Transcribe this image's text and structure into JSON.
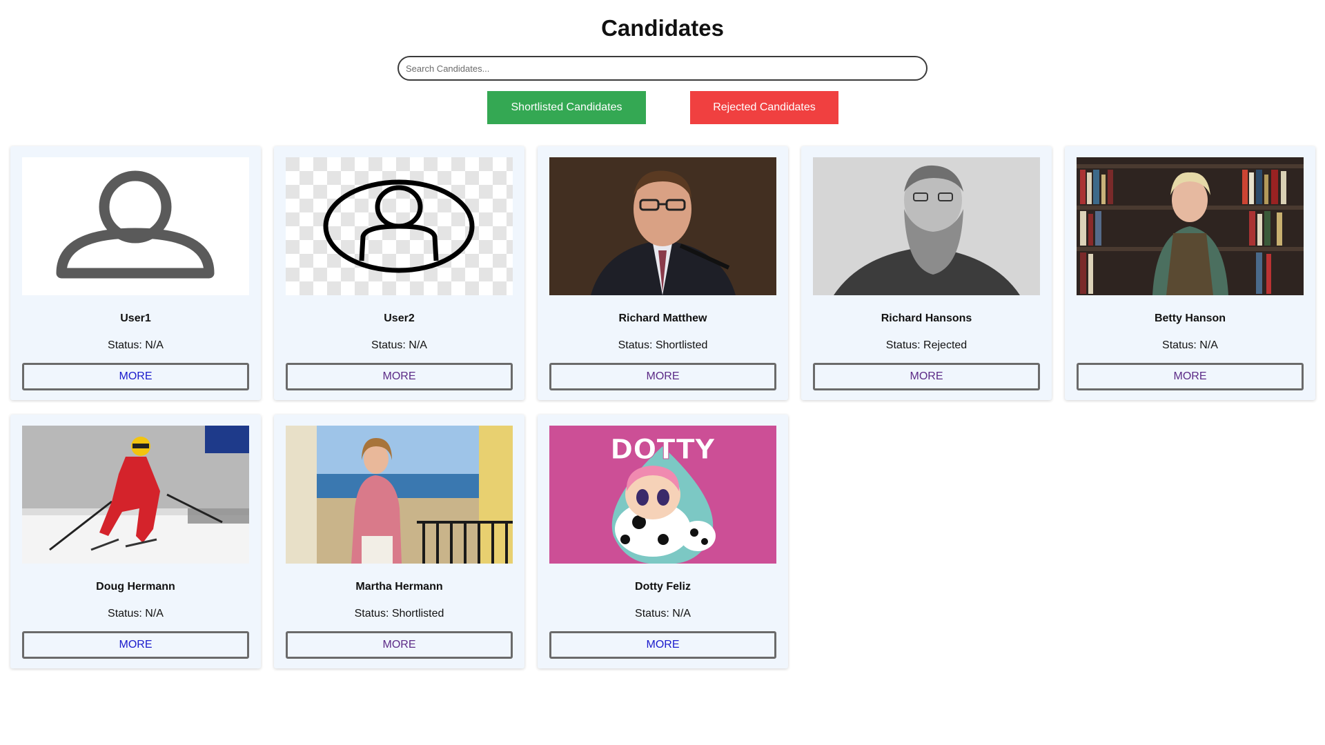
{
  "header": {
    "title": "Candidates"
  },
  "search": {
    "placeholder": "Search Candidates..."
  },
  "filters": {
    "shortlisted_label": "Shortlisted Candidates",
    "shortlisted_color": "#34a853",
    "rejected_label": "Rejected Candidates",
    "rejected_color": "#f04040"
  },
  "more_label": "MORE",
  "candidates": [
    {
      "name": "User1",
      "status": "Status: N/A",
      "photo": "person-outline-icon"
    },
    {
      "name": "User2",
      "status": "Status: N/A",
      "photo": "person-circle-icon"
    },
    {
      "name": "Richard Matthew",
      "status": "Status: Shortlisted",
      "photo": "man-with-microphone-photo"
    },
    {
      "name": "Richard Hansons",
      "status": "Status: Rejected",
      "photo": "bearded-man-engraving-photo"
    },
    {
      "name": "Betty Hanson",
      "status": "Status: N/A",
      "photo": "woman-at-bookshelf-photo"
    },
    {
      "name": "Doug Hermann",
      "status": "Status: N/A",
      "photo": "skier-photo"
    },
    {
      "name": "Martha Hermann",
      "status": "Status: Shortlisted",
      "photo": "woman-on-balcony-photo"
    },
    {
      "name": "Dotty Feliz",
      "status": "Status: N/A",
      "photo": "dotty-doll-photo"
    }
  ]
}
